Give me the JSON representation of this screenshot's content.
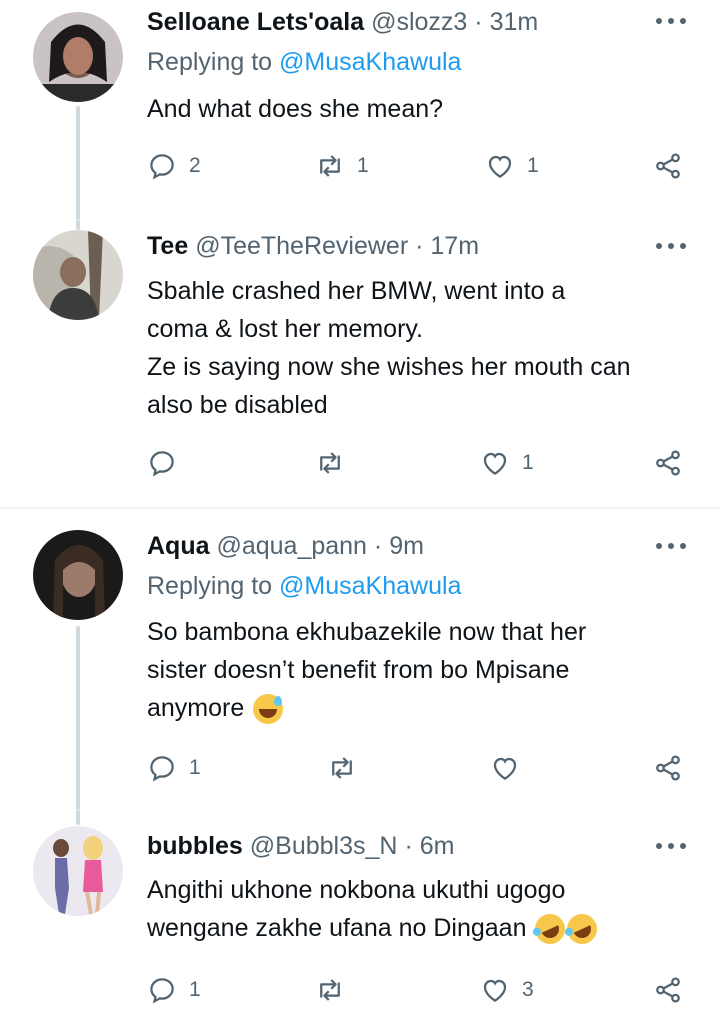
{
  "tweets": [
    {
      "name": "Selloane Lets'oala",
      "handle": "@slozz3",
      "separator": "·",
      "time": "31m",
      "replying_prefix": "Replying to",
      "replying_mention": "@MusaKhawula",
      "lines": [
        "And what does she mean?"
      ],
      "replies": "2",
      "retweets": "1",
      "likes": "1",
      "avatar_color": "#3a2e33"
    },
    {
      "name": "Tee",
      "handle": "@TeeTheReviewer",
      "separator": "·",
      "time": "17m",
      "lines": [
        "Sbahle crashed her BMW, went into a",
        "coma & lost her memory.",
        "Ze is saying now she wishes her mouth can",
        "also be disabled"
      ],
      "replies": "",
      "retweets": "",
      "likes": "1",
      "avatar_color": "#8a8a8a"
    },
    {
      "name": "Aqua",
      "handle": "@aqua_pann",
      "separator": "·",
      "time": "9m",
      "replying_prefix": "Replying to",
      "replying_mention": "@MusaKhawula",
      "lines": [
        "So bambona ekhubazekile now that her",
        "sister doesn’t benefit from bo Mpisane",
        "anymore"
      ],
      "emoji": "grinning-face-with-sweat",
      "replies": "1",
      "retweets": "",
      "likes": "",
      "avatar_color": "#2b2522"
    },
    {
      "name": "bubbles",
      "handle": "@Bubbl3s_N",
      "separator": "·",
      "time": "6m",
      "lines": [
        "Angithi ukhone nokbona ukuthi ugogo",
        "wengane zakhe ufana no Dingaan"
      ],
      "emoji": "rolling-on-the-floor-laughing",
      "replies": "1",
      "retweets": "",
      "likes": "3",
      "avatar_color": "#e9e4ec"
    }
  ],
  "colors": {
    "text": "#0f1419",
    "secondary": "#536471",
    "link": "#1d9bf0",
    "thread_line": "#cfd9de",
    "divider": "#eff3f4"
  },
  "icons": [
    "reply-icon",
    "retweet-icon",
    "like-icon",
    "share-icon",
    "more-icon"
  ]
}
